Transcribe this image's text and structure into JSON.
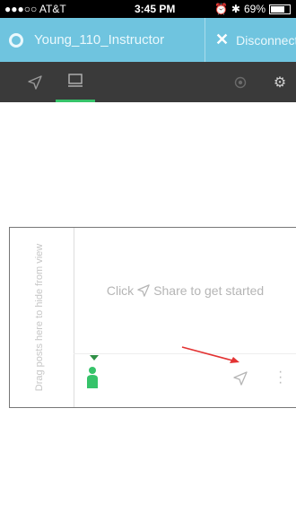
{
  "status_bar": {
    "carrier": "●●●○○ AT&T",
    "time": "3:45 PM",
    "battery": "69%"
  },
  "header": {
    "session_name": "Young_110_Instructor",
    "disconnect_label": "Disconnect"
  },
  "toolbar": {
    "icons": [
      "share-tab-icon",
      "screen-tab-icon",
      "record-icon",
      "settings-gear-icon"
    ],
    "active_tab": "screen"
  },
  "panel": {
    "hide_hint": "Drag posts here to hide from view",
    "placeholder_before": "Click",
    "placeholder_after": "Share to get started"
  },
  "colors": {
    "header_bg": "#6fc4df",
    "toolbar_bg": "#3a3a3a",
    "active_tab_accent": "#36c36a",
    "person_icon": "#36c36a",
    "annotation_arrow": "#e33333"
  }
}
